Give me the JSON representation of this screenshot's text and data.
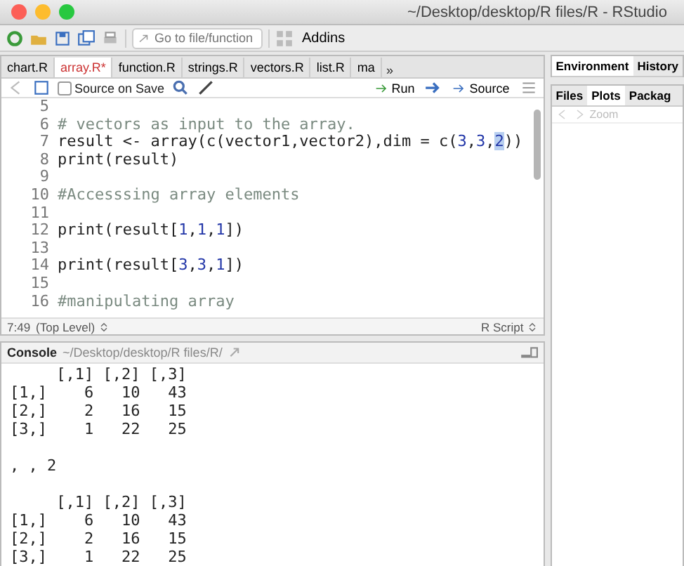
{
  "window": {
    "title": "~/Desktop/desktop/R files/R - RStudio"
  },
  "toolbar": {
    "goto_placeholder": "Go to file/function",
    "addins": "Addins"
  },
  "editor": {
    "tabs": [
      {
        "label": "chart.R",
        "selected": false,
        "modified": false
      },
      {
        "label": "array.R*",
        "selected": true,
        "modified": true
      },
      {
        "label": "function.R",
        "selected": false,
        "modified": false
      },
      {
        "label": "strings.R",
        "selected": false,
        "modified": false
      },
      {
        "label": "vectors.R",
        "selected": false,
        "modified": false
      },
      {
        "label": "list.R",
        "selected": false,
        "modified": false
      },
      {
        "label": "ma",
        "selected": false,
        "modified": false
      }
    ],
    "overflow": "»",
    "source_on_save": {
      "label": "Source on Save",
      "checked": false
    },
    "run": "Run",
    "source": "Source",
    "lines": [
      {
        "number": "5"
      },
      {
        "number": "6",
        "tokens": [
          {
            "text": "# vectors as input to the array.",
            "kind": "comment"
          }
        ]
      },
      {
        "number": "7",
        "tokens": [
          {
            "text": "result <- array(c(vector1,vector2),dim = c(",
            "kind": "plain"
          },
          {
            "text": "3",
            "kind": "number"
          },
          {
            "text": ",",
            "kind": "plain"
          },
          {
            "text": "3",
            "kind": "number"
          },
          {
            "text": ",",
            "kind": "plain"
          },
          {
            "text": "2",
            "kind": "selection"
          },
          {
            "text": "))",
            "kind": "plain"
          }
        ]
      },
      {
        "number": "8",
        "tokens": [
          {
            "text": "print(result)",
            "kind": "plain"
          }
        ]
      },
      {
        "number": "9"
      },
      {
        "number": "10",
        "tokens": [
          {
            "text": "#Accesssing array elements",
            "kind": "comment"
          }
        ]
      },
      {
        "number": "11"
      },
      {
        "number": "12",
        "tokens": [
          {
            "text": "print(result[",
            "kind": "plain"
          },
          {
            "text": "1",
            "kind": "number"
          },
          {
            "text": ",",
            "kind": "plain"
          },
          {
            "text": "1",
            "kind": "number"
          },
          {
            "text": ",",
            "kind": "plain"
          },
          {
            "text": "1",
            "kind": "number"
          },
          {
            "text": "])",
            "kind": "plain"
          }
        ]
      },
      {
        "number": "13"
      },
      {
        "number": "14",
        "tokens": [
          {
            "text": "print(result[",
            "kind": "plain"
          },
          {
            "text": "3",
            "kind": "number"
          },
          {
            "text": ",",
            "kind": "plain"
          },
          {
            "text": "3",
            "kind": "number"
          },
          {
            "text": ",",
            "kind": "plain"
          },
          {
            "text": "1",
            "kind": "number"
          },
          {
            "text": "])",
            "kind": "plain"
          }
        ]
      },
      {
        "number": "15"
      },
      {
        "number": "16",
        "tokens": [
          {
            "text": "#manipulating array",
            "kind": "comment"
          }
        ]
      }
    ],
    "status": {
      "position": "7:49",
      "scope": "(Top Level)",
      "file_type": "R Script"
    }
  },
  "console": {
    "title": "Console",
    "path": "~/Desktop/desktop/R files/R/",
    "output": [
      {
        "kind": "text",
        "text": "     [,1] [,2] [,3]"
      },
      {
        "kind": "text",
        "text": "[1,]    6   10   43"
      },
      {
        "kind": "text",
        "text": "[2,]    2   16   15"
      },
      {
        "kind": "text",
        "text": "[3,]    1   22   25"
      },
      {
        "kind": "blank"
      },
      {
        "kind": "text",
        "text": ", , 2"
      },
      {
        "kind": "blank"
      },
      {
        "kind": "text",
        "text": "     [,1] [,2] [,3]"
      },
      {
        "kind": "text",
        "text": "[1,]    6   10   43"
      },
      {
        "kind": "text",
        "text": "[2,]    2   16   15"
      },
      {
        "kind": "text",
        "text": "[3,]    1   22   25"
      }
    ]
  },
  "right_pane": {
    "top_tabs": [
      {
        "label": "Environment",
        "selected": true
      },
      {
        "label": "History",
        "selected": false
      }
    ],
    "bottom_tabs": [
      {
        "label": "Files",
        "selected": false
      },
      {
        "label": "Plots",
        "selected": true
      },
      {
        "label": "Packag",
        "selected": false
      }
    ],
    "zoom": "Zoom"
  }
}
